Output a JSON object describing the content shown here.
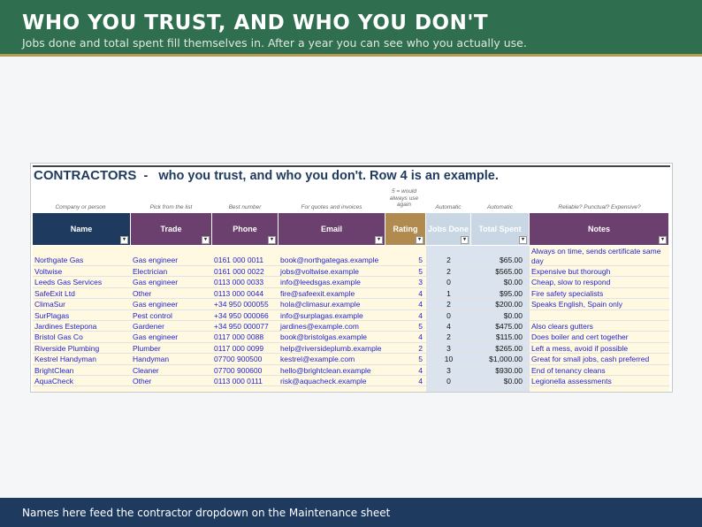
{
  "banner": {
    "title": "WHO YOU TRUST, AND WHO YOU DON'T",
    "subtitle": "Jobs done and total spent fill themselves in. After a year you can see who you actually use."
  },
  "footer": {
    "text": "Names here feed the contractor dropdown on the Maintenance sheet"
  },
  "sheet": {
    "heading_bold": "CONTRACTORS",
    "heading_rest": "  -   who you trust, and who you don't. Row 4 is an example.",
    "hints": {
      "name": "Company or person",
      "trade": "Pick from the list",
      "phone": "Best number",
      "email": "For quotes and invoices",
      "rating": "5 = would always use again",
      "jobs": "Automatic",
      "spent": "Automatic",
      "notes": "Reliable? Punctual? Expensive?"
    },
    "columns": {
      "name": "Name",
      "trade": "Trade",
      "phone": "Phone",
      "email": "Email",
      "rating": "Rating",
      "jobs": "Jobs Done",
      "spent": "Total Spent",
      "notes": "Notes"
    },
    "dropdown_glyph": "▾",
    "rows": [
      {
        "name": "Northgate Gas",
        "trade": "Gas engineer",
        "phone": "0161 000 0011",
        "email": "book@northgategas.example",
        "rating": "5",
        "jobs": "2",
        "spent": "$65.00",
        "notes": "Always on time, sends certificate same day"
      },
      {
        "name": "Voltwise",
        "trade": "Electrician",
        "phone": "0161 000 0022",
        "email": "jobs@voltwise.example",
        "rating": "5",
        "jobs": "2",
        "spent": "$565.00",
        "notes": "Expensive but thorough"
      },
      {
        "name": "Leeds Gas Services",
        "trade": "Gas engineer",
        "phone": "0113 000 0033",
        "email": "info@leedsgas.example",
        "rating": "3",
        "jobs": "0",
        "spent": "$0.00",
        "notes": "Cheap, slow to respond"
      },
      {
        "name": "SafeExit Ltd",
        "trade": "Other",
        "phone": "0113 000 0044",
        "email": "fire@safeexit.example",
        "rating": "4",
        "jobs": "1",
        "spent": "$95.00",
        "notes": "Fire safety specialists"
      },
      {
        "name": "ClimaSur",
        "trade": "Gas engineer",
        "phone": "+34 950 000055",
        "email": "hola@climasur.example",
        "rating": "4",
        "jobs": "2",
        "spent": "$200.00",
        "notes": "Speaks English, Spain only"
      },
      {
        "name": "SurPlagas",
        "trade": "Pest control",
        "phone": "+34 950 000066",
        "email": "info@surplagas.example",
        "rating": "4",
        "jobs": "0",
        "spent": "$0.00",
        "notes": ""
      },
      {
        "name": "Jardines Estepona",
        "trade": "Gardener",
        "phone": "+34 950 000077",
        "email": "jardines@example.com",
        "rating": "5",
        "jobs": "4",
        "spent": "$475.00",
        "notes": "Also clears gutters"
      },
      {
        "name": "Bristol Gas Co",
        "trade": "Gas engineer",
        "phone": "0117 000 0088",
        "email": "book@bristolgas.example",
        "rating": "4",
        "jobs": "2",
        "spent": "$115.00",
        "notes": "Does boiler and cert together"
      },
      {
        "name": "Riverside Plumbing",
        "trade": "Plumber",
        "phone": "0117 000 0099",
        "email": "help@riversideplumb.example",
        "rating": "2",
        "jobs": "3",
        "spent": "$265.00",
        "notes": "Left a mess, avoid if possible"
      },
      {
        "name": "Kestrel Handyman",
        "trade": "Handyman",
        "phone": "07700 900500",
        "email": "kestrel@example.com",
        "rating": "5",
        "jobs": "10",
        "spent": "$1,000.00",
        "notes": "Great for small jobs, cash preferred"
      },
      {
        "name": "BrightClean",
        "trade": "Cleaner",
        "phone": "07700 900600",
        "email": "hello@brightclean.example",
        "rating": "4",
        "jobs": "3",
        "spent": "$930.00",
        "notes": "End of tenancy cleans"
      },
      {
        "name": "AquaCheck",
        "trade": "Other",
        "phone": "0113 000 0111",
        "email": "risk@aquacheck.example",
        "rating": "4",
        "jobs": "0",
        "spent": "$0.00",
        "notes": "Legionella assessments"
      }
    ]
  }
}
